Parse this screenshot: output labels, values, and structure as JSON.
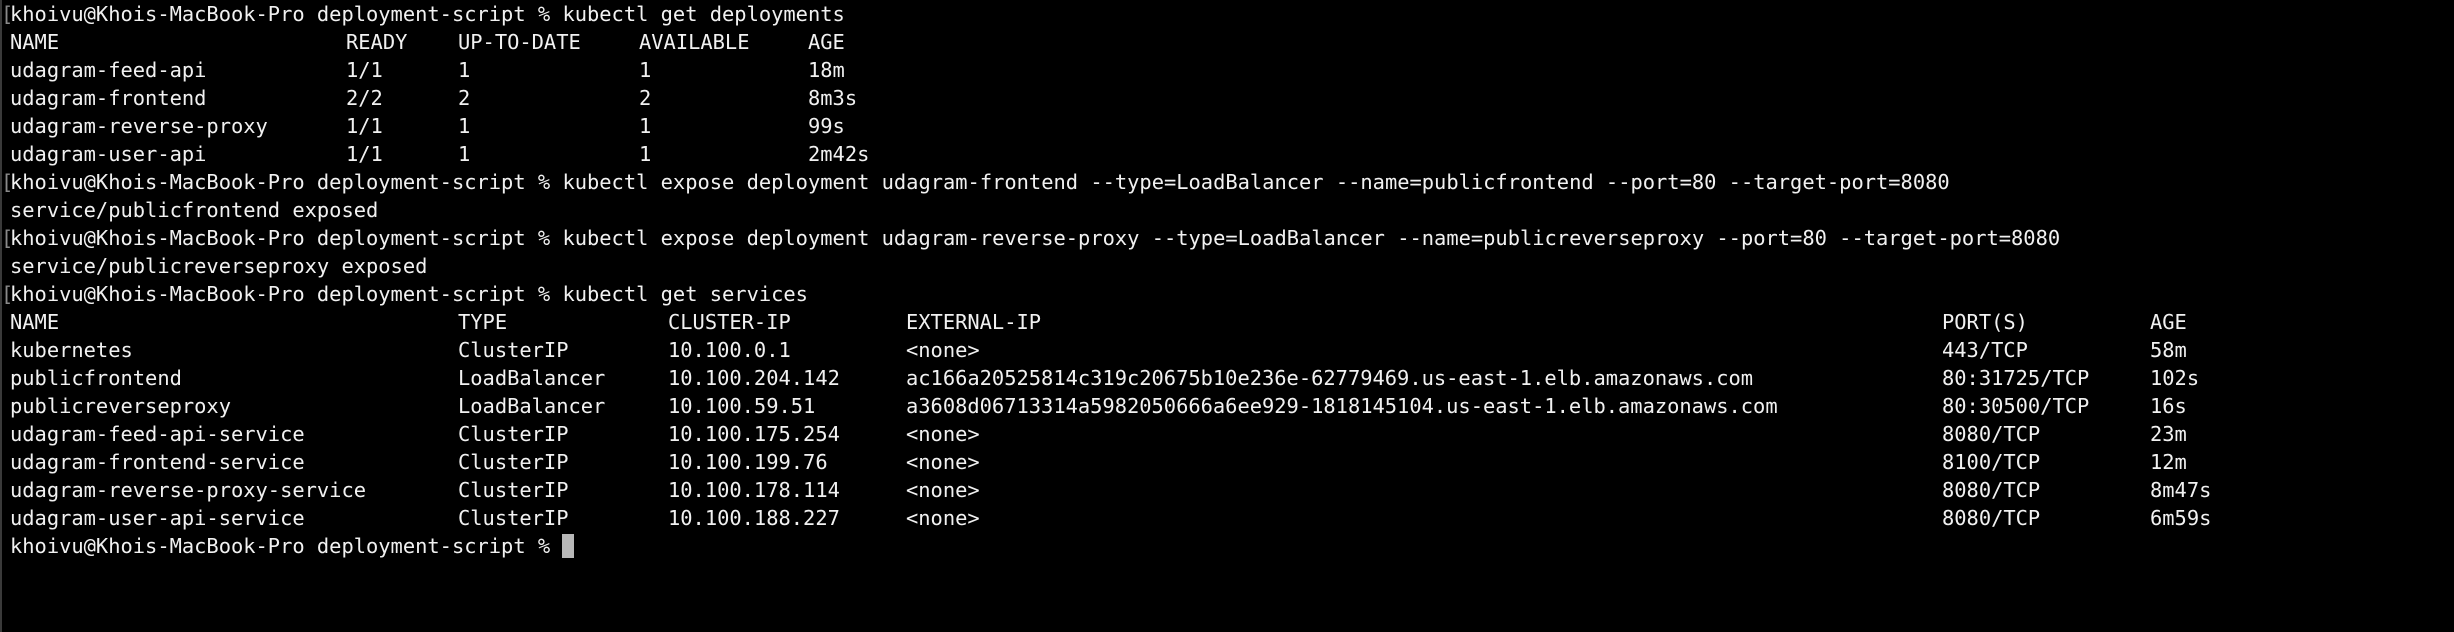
{
  "prompt": "khoivu@Khois-MacBook-Pro deployment-script % ",
  "cmd_get_deployments": "kubectl get deployments",
  "deployments": {
    "headers": [
      "NAME",
      "READY",
      "UP-TO-DATE",
      "AVAILABLE",
      "AGE"
    ],
    "rows": [
      [
        "udagram-feed-api",
        "1/1",
        "1",
        "1",
        "18m"
      ],
      [
        "udagram-frontend",
        "2/2",
        "2",
        "2",
        "8m3s"
      ],
      [
        "udagram-reverse-proxy",
        "1/1",
        "1",
        "1",
        "99s"
      ],
      [
        "udagram-user-api",
        "1/1",
        "1",
        "1",
        "2m42s"
      ]
    ]
  },
  "cmd_expose_frontend": "kubectl expose deployment udagram-frontend --type=LoadBalancer --name=publicfrontend --port=80 --target-port=8080",
  "out_expose_frontend": "service/publicfrontend exposed",
  "cmd_expose_proxy": "kubectl expose deployment udagram-reverse-proxy --type=LoadBalancer --name=publicreverseproxy --port=80 --target-port=8080",
  "out_expose_proxy": "service/publicreverseproxy exposed",
  "cmd_get_services": "kubectl get services",
  "services": {
    "headers": [
      "NAME",
      "TYPE",
      "CLUSTER-IP",
      "EXTERNAL-IP",
      "PORT(S)",
      "AGE"
    ],
    "rows": [
      [
        "kubernetes",
        "ClusterIP",
        "10.100.0.1",
        "<none>",
        "443/TCP",
        "58m"
      ],
      [
        "publicfrontend",
        "LoadBalancer",
        "10.100.204.142",
        "ac166a20525814c319c20675b10e236e-62779469.us-east-1.elb.amazonaws.com",
        "80:31725/TCP",
        "102s"
      ],
      [
        "publicreverseproxy",
        "LoadBalancer",
        "10.100.59.51",
        "a3608d06713314a5982050666a6ee929-1818145104.us-east-1.elb.amazonaws.com",
        "80:30500/TCP",
        "16s"
      ],
      [
        "udagram-feed-api-service",
        "ClusterIP",
        "10.100.175.254",
        "<none>",
        "8080/TCP",
        "23m"
      ],
      [
        "udagram-frontend-service",
        "ClusterIP",
        "10.100.199.76",
        "<none>",
        "8100/TCP",
        "12m"
      ],
      [
        "udagram-reverse-proxy-service",
        "ClusterIP",
        "10.100.178.114",
        "<none>",
        "8080/TCP",
        "8m47s"
      ],
      [
        "udagram-user-api-service",
        "ClusterIP",
        "10.100.188.227",
        "<none>",
        "8080/TCP",
        "6m59s"
      ]
    ]
  },
  "colors": {
    "background": "#000000",
    "foreground": "#f1f1f1",
    "cursor": "#b8b8b8"
  }
}
